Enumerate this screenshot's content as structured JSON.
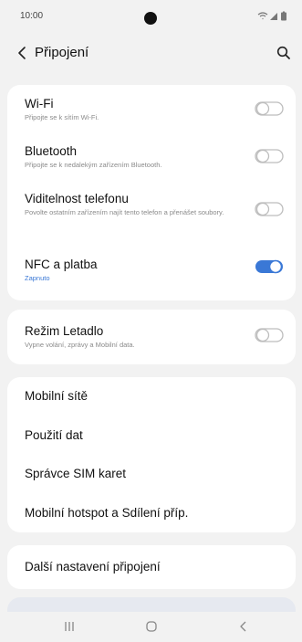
{
  "status_bar": {
    "time": "10:00"
  },
  "header": {
    "title": "Připojení"
  },
  "toggles": [
    {
      "title": "Wi-Fi",
      "subtitle": "Připojte se k sítím Wi-Fi.",
      "enabled": false
    },
    {
      "title": "Bluetooth",
      "subtitle": "Připojte se k nedalekým zařízením Bluetooth.",
      "enabled": false
    },
    {
      "title": "Viditelnost telefonu",
      "subtitle": "Povolte ostatním zařízením najít tento telefon a přenášet soubory.",
      "enabled": false
    },
    {
      "title": "NFC a platba",
      "subtitle": "Zapnuto",
      "enabled": true
    },
    {
      "title": "Režim Letadlo",
      "subtitle": "Vypne volání, zprávy a Mobilní data.",
      "enabled": false
    }
  ],
  "menu": [
    "Mobilní sítě",
    "Použití dat",
    "Správce SIM karet",
    "Mobilní hotspot a Sdílení příp.",
    "Další nastavení připojení"
  ],
  "colors": {
    "accent": "#3a78d6",
    "toggle_off": "#bdbdbd",
    "background": "#f2f2f2"
  },
  "icons": {
    "back": "chevron-left-icon",
    "search": "search-icon",
    "nav_recents": "recents-icon",
    "nav_home": "home-icon",
    "nav_back": "back-icon"
  }
}
